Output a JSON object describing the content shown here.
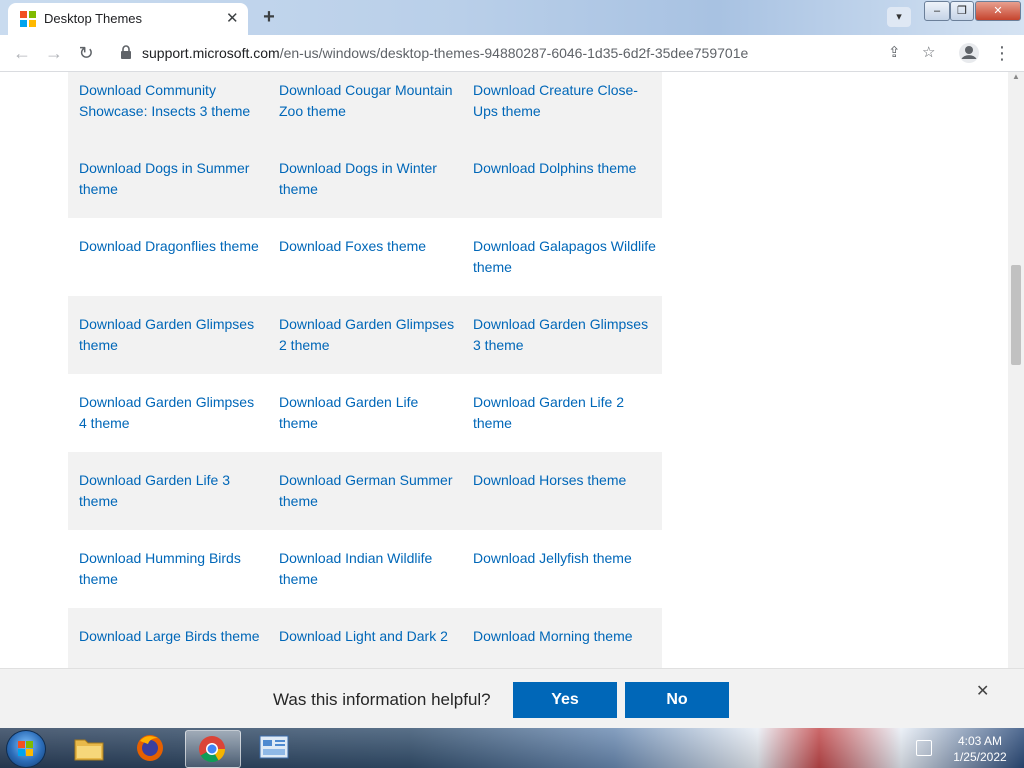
{
  "browser": {
    "tab_title": "Desktop Themes",
    "url_host": "support.microsoft.com",
    "url_path": "/en-us/windows/desktop-themes-94880287-6046-1d35-6d2f-35dee759701e"
  },
  "themes": {
    "rows": [
      [
        "Download Community Showcase: Insects 3 theme",
        "Download Cougar Mountain Zoo theme",
        "Download Creature Close-Ups theme"
      ],
      [
        "Download Dogs in Summer theme",
        "Download Dogs in Winter theme",
        "Download Dolphins theme"
      ],
      [
        "Download Dragonflies theme",
        "Download Foxes theme",
        "Download Galapagos Wildlife theme"
      ],
      [
        "Download Garden Glimpses theme",
        "Download Garden Glimpses 2 theme",
        "Download Garden Glimpses 3 theme"
      ],
      [
        "Download Garden Glimpses 4 theme",
        "Download Garden Life theme",
        "Download Garden Life 2 theme"
      ],
      [
        "Download Garden Life 3 theme",
        "Download German Summer theme",
        "Download Horses theme"
      ],
      [
        "Download Humming Birds theme",
        "Download Indian Wildlife theme",
        "Download Jellyfish theme"
      ],
      [
        "Download Large Birds theme",
        "Download Light and Dark 2",
        "Download Morning theme"
      ]
    ]
  },
  "feedback": {
    "question": "Was this information helpful?",
    "yes_label": "Yes",
    "no_label": "No"
  },
  "taskbar": {
    "apps": [
      "windows-explorer",
      "firefox",
      "chrome",
      "control-panel"
    ],
    "time": "4:03 AM",
    "date": "1/25/2022"
  },
  "colors": {
    "link": "#0067b8",
    "button": "#0067b8",
    "row_shade": "#f2f2f2"
  }
}
